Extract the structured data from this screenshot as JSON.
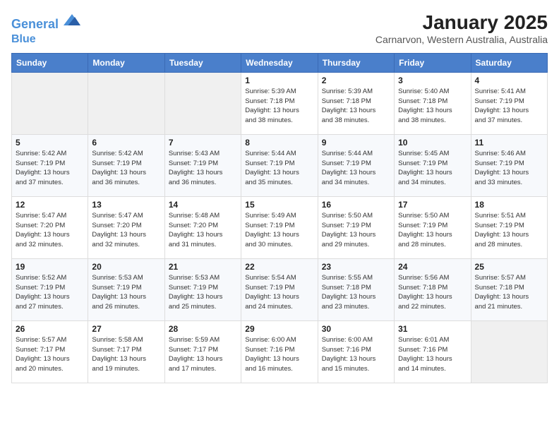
{
  "header": {
    "logo_line1": "General",
    "logo_line2": "Blue",
    "title": "January 2025",
    "subtitle": "Carnarvon, Western Australia, Australia"
  },
  "weekdays": [
    "Sunday",
    "Monday",
    "Tuesday",
    "Wednesday",
    "Thursday",
    "Friday",
    "Saturday"
  ],
  "weeks": [
    [
      {
        "day": "",
        "detail": ""
      },
      {
        "day": "",
        "detail": ""
      },
      {
        "day": "",
        "detail": ""
      },
      {
        "day": "1",
        "detail": "Sunrise: 5:39 AM\nSunset: 7:18 PM\nDaylight: 13 hours\nand 38 minutes."
      },
      {
        "day": "2",
        "detail": "Sunrise: 5:39 AM\nSunset: 7:18 PM\nDaylight: 13 hours\nand 38 minutes."
      },
      {
        "day": "3",
        "detail": "Sunrise: 5:40 AM\nSunset: 7:18 PM\nDaylight: 13 hours\nand 38 minutes."
      },
      {
        "day": "4",
        "detail": "Sunrise: 5:41 AM\nSunset: 7:19 PM\nDaylight: 13 hours\nand 37 minutes."
      }
    ],
    [
      {
        "day": "5",
        "detail": "Sunrise: 5:42 AM\nSunset: 7:19 PM\nDaylight: 13 hours\nand 37 minutes."
      },
      {
        "day": "6",
        "detail": "Sunrise: 5:42 AM\nSunset: 7:19 PM\nDaylight: 13 hours\nand 36 minutes."
      },
      {
        "day": "7",
        "detail": "Sunrise: 5:43 AM\nSunset: 7:19 PM\nDaylight: 13 hours\nand 36 minutes."
      },
      {
        "day": "8",
        "detail": "Sunrise: 5:44 AM\nSunset: 7:19 PM\nDaylight: 13 hours\nand 35 minutes."
      },
      {
        "day": "9",
        "detail": "Sunrise: 5:44 AM\nSunset: 7:19 PM\nDaylight: 13 hours\nand 34 minutes."
      },
      {
        "day": "10",
        "detail": "Sunrise: 5:45 AM\nSunset: 7:19 PM\nDaylight: 13 hours\nand 34 minutes."
      },
      {
        "day": "11",
        "detail": "Sunrise: 5:46 AM\nSunset: 7:19 PM\nDaylight: 13 hours\nand 33 minutes."
      }
    ],
    [
      {
        "day": "12",
        "detail": "Sunrise: 5:47 AM\nSunset: 7:20 PM\nDaylight: 13 hours\nand 32 minutes."
      },
      {
        "day": "13",
        "detail": "Sunrise: 5:47 AM\nSunset: 7:20 PM\nDaylight: 13 hours\nand 32 minutes."
      },
      {
        "day": "14",
        "detail": "Sunrise: 5:48 AM\nSunset: 7:20 PM\nDaylight: 13 hours\nand 31 minutes."
      },
      {
        "day": "15",
        "detail": "Sunrise: 5:49 AM\nSunset: 7:19 PM\nDaylight: 13 hours\nand 30 minutes."
      },
      {
        "day": "16",
        "detail": "Sunrise: 5:50 AM\nSunset: 7:19 PM\nDaylight: 13 hours\nand 29 minutes."
      },
      {
        "day": "17",
        "detail": "Sunrise: 5:50 AM\nSunset: 7:19 PM\nDaylight: 13 hours\nand 28 minutes."
      },
      {
        "day": "18",
        "detail": "Sunrise: 5:51 AM\nSunset: 7:19 PM\nDaylight: 13 hours\nand 28 minutes."
      }
    ],
    [
      {
        "day": "19",
        "detail": "Sunrise: 5:52 AM\nSunset: 7:19 PM\nDaylight: 13 hours\nand 27 minutes."
      },
      {
        "day": "20",
        "detail": "Sunrise: 5:53 AM\nSunset: 7:19 PM\nDaylight: 13 hours\nand 26 minutes."
      },
      {
        "day": "21",
        "detail": "Sunrise: 5:53 AM\nSunset: 7:19 PM\nDaylight: 13 hours\nand 25 minutes."
      },
      {
        "day": "22",
        "detail": "Sunrise: 5:54 AM\nSunset: 7:19 PM\nDaylight: 13 hours\nand 24 minutes."
      },
      {
        "day": "23",
        "detail": "Sunrise: 5:55 AM\nSunset: 7:18 PM\nDaylight: 13 hours\nand 23 minutes."
      },
      {
        "day": "24",
        "detail": "Sunrise: 5:56 AM\nSunset: 7:18 PM\nDaylight: 13 hours\nand 22 minutes."
      },
      {
        "day": "25",
        "detail": "Sunrise: 5:57 AM\nSunset: 7:18 PM\nDaylight: 13 hours\nand 21 minutes."
      }
    ],
    [
      {
        "day": "26",
        "detail": "Sunrise: 5:57 AM\nSunset: 7:17 PM\nDaylight: 13 hours\nand 20 minutes."
      },
      {
        "day": "27",
        "detail": "Sunrise: 5:58 AM\nSunset: 7:17 PM\nDaylight: 13 hours\nand 19 minutes."
      },
      {
        "day": "28",
        "detail": "Sunrise: 5:59 AM\nSunset: 7:17 PM\nDaylight: 13 hours\nand 17 minutes."
      },
      {
        "day": "29",
        "detail": "Sunrise: 6:00 AM\nSunset: 7:16 PM\nDaylight: 13 hours\nand 16 minutes."
      },
      {
        "day": "30",
        "detail": "Sunrise: 6:00 AM\nSunset: 7:16 PM\nDaylight: 13 hours\nand 15 minutes."
      },
      {
        "day": "31",
        "detail": "Sunrise: 6:01 AM\nSunset: 7:16 PM\nDaylight: 13 hours\nand 14 minutes."
      },
      {
        "day": "",
        "detail": ""
      }
    ]
  ]
}
